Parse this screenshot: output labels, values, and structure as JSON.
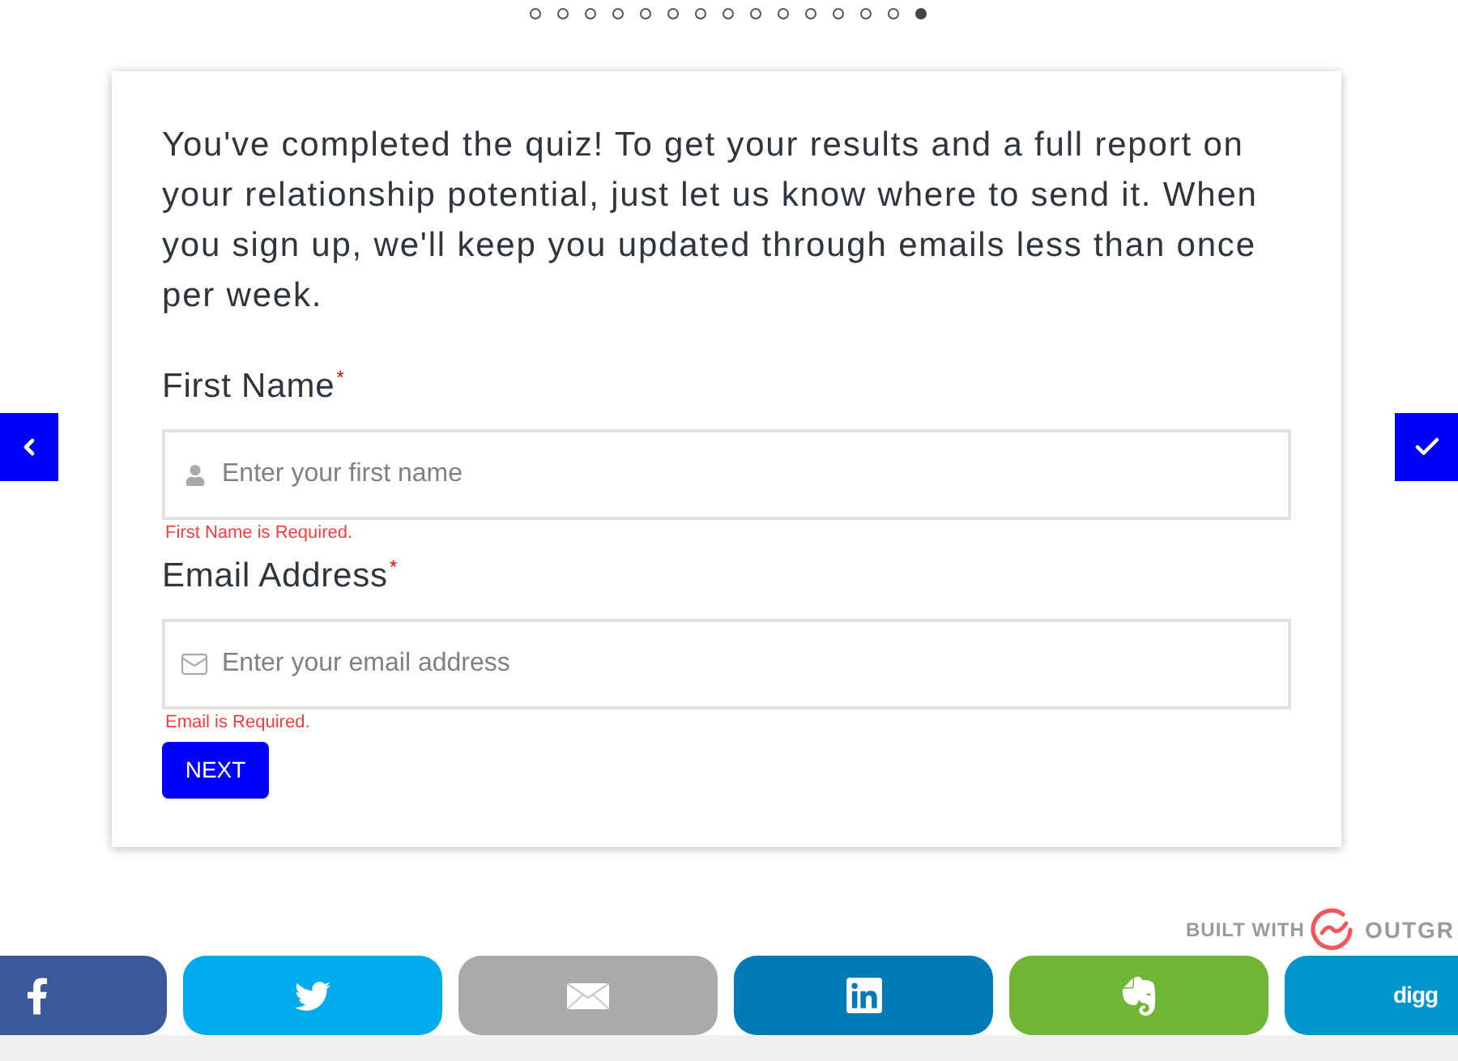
{
  "progress": {
    "steps": [
      {
        "selected": false
      },
      {
        "selected": false
      },
      {
        "selected": false
      },
      {
        "selected": false
      },
      {
        "selected": false
      },
      {
        "selected": false
      },
      {
        "selected": false
      },
      {
        "selected": false
      },
      {
        "selected": false
      },
      {
        "selected": false
      },
      {
        "selected": false
      },
      {
        "selected": false
      },
      {
        "selected": false
      },
      {
        "selected": false
      },
      {
        "selected": true
      }
    ]
  },
  "form": {
    "intro": "You've completed the quiz! To get your results and a full report on your relationship potential, just let us know where to send it. When you sign up, we'll keep you updated through emails less than once per week.",
    "fields": [
      {
        "kind": "text",
        "label": "First Name",
        "required_mark": "*",
        "placeholder": "Enter your first name",
        "error": "First Name is Required."
      },
      {
        "kind": "email",
        "label": "Email Address",
        "required_mark": "*",
        "placeholder": "Enter your email address",
        "error": "Email is Required."
      }
    ],
    "submit_button": "NEXT"
  },
  "badge": {
    "prefix": "BUILT WITH",
    "brand": "OUTGR"
  },
  "share_buttons": [
    {
      "kind": "facebook",
      "color": "#3b5998"
    },
    {
      "kind": "twitter",
      "color": "#00acee"
    },
    {
      "kind": "email",
      "color": "#aaaaaa"
    },
    {
      "kind": "linkedin",
      "color": "#007bb5"
    },
    {
      "kind": "evernote",
      "color": "#6fb536"
    },
    {
      "kind": "digg",
      "label": "digg",
      "color": "#0094cc"
    }
  ]
}
